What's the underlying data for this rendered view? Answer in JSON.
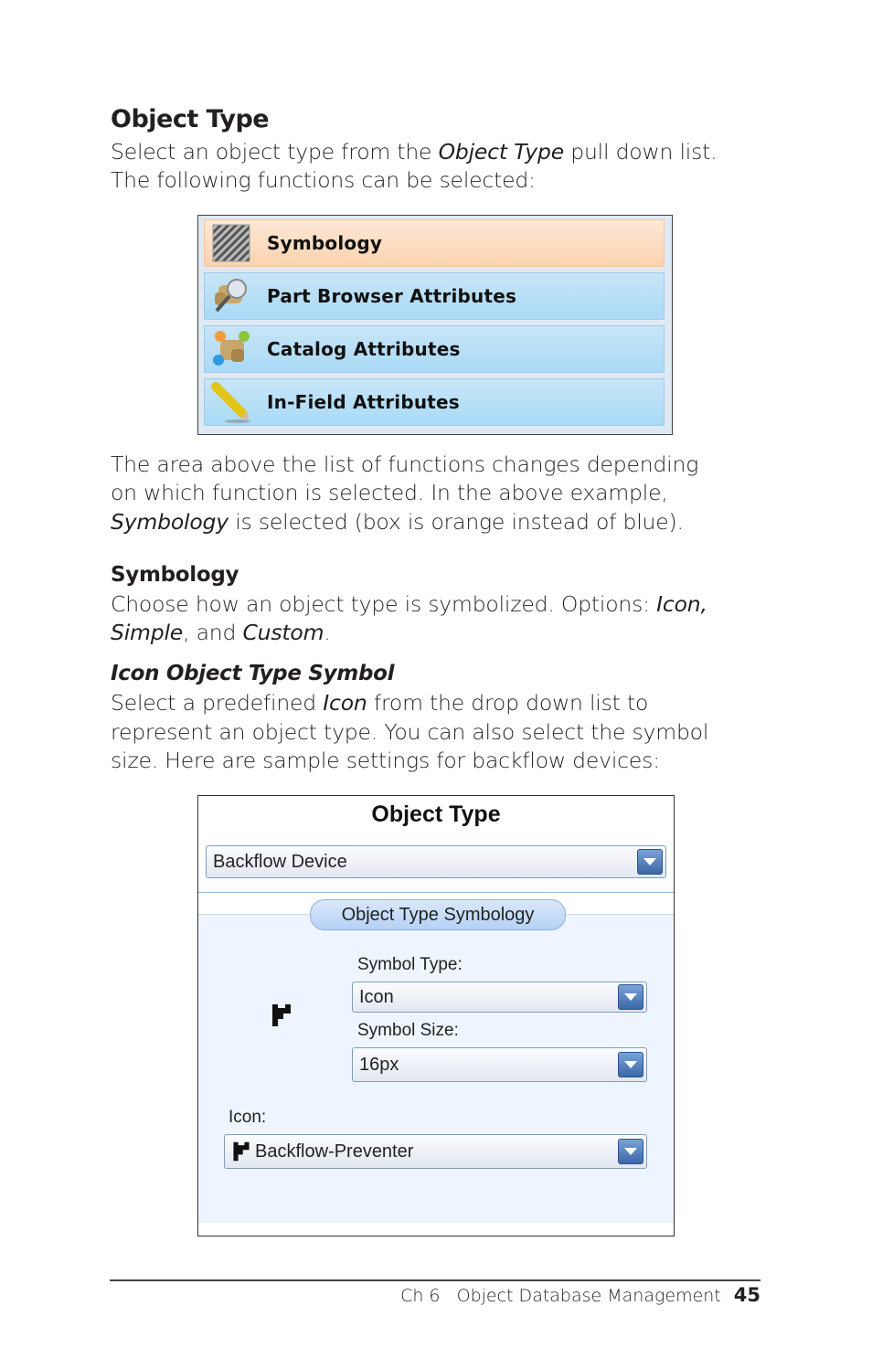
{
  "heading": "Object Type",
  "intro": {
    "line1_pre": "Select an object type from the ",
    "line1_em": "Object Type",
    "line1_post": " pull down list.",
    "line2": "The following functions can be selected:"
  },
  "functions": [
    {
      "label": "Symbology",
      "icon": "hatched-square-icon",
      "selected": true
    },
    {
      "label": "Part Browser Attributes",
      "icon": "part-magnifier-icon",
      "selected": false
    },
    {
      "label": "Catalog Attributes",
      "icon": "numbered-parts-icon",
      "selected": false
    },
    {
      "label": "In-Field Attributes",
      "icon": "pencil-icon",
      "selected": false
    }
  ],
  "para2": {
    "line1": "The area above the list of functions changes depending",
    "line2": "on which function is selected. In the above example,",
    "line3_em": "Symbology",
    "line3_post": " is selected (box is orange instead of blue)."
  },
  "symbology": {
    "heading": "Symbology",
    "line1_pre": "Choose how an object type is symbolized. Options: ",
    "line1_em": "Icon,",
    "line2_em1": "Simple",
    "line2_mid": ", and ",
    "line2_em2": "Custom",
    "line2_post": "."
  },
  "icon_section": {
    "heading": "Icon Object Type Symbol",
    "line1_pre": "Select a predefined ",
    "line1_em": "Icon",
    "line1_post": " from the drop down list to",
    "line2": "represent an object type. You can also select the symbol",
    "line3": "size. Here are sample settings for backflow devices:"
  },
  "dialog": {
    "title": "Object Type",
    "object_type_value": "Backflow Device",
    "group_label": "Object Type Symbology",
    "symbol_type_label": "Symbol Type:",
    "symbol_type_value": "Icon",
    "symbol_size_label": "Symbol Size:",
    "symbol_size_value": "16px",
    "icon_label": "Icon:",
    "icon_value": "Backflow-Preventer"
  },
  "colors": {
    "selected_item": "#fbd2ae",
    "unselected_item": "#a9daf6",
    "dropdown_button": "#3b67a8"
  },
  "footer": {
    "chapter": "Ch 6",
    "title": "Object Database Management",
    "page": "45"
  }
}
